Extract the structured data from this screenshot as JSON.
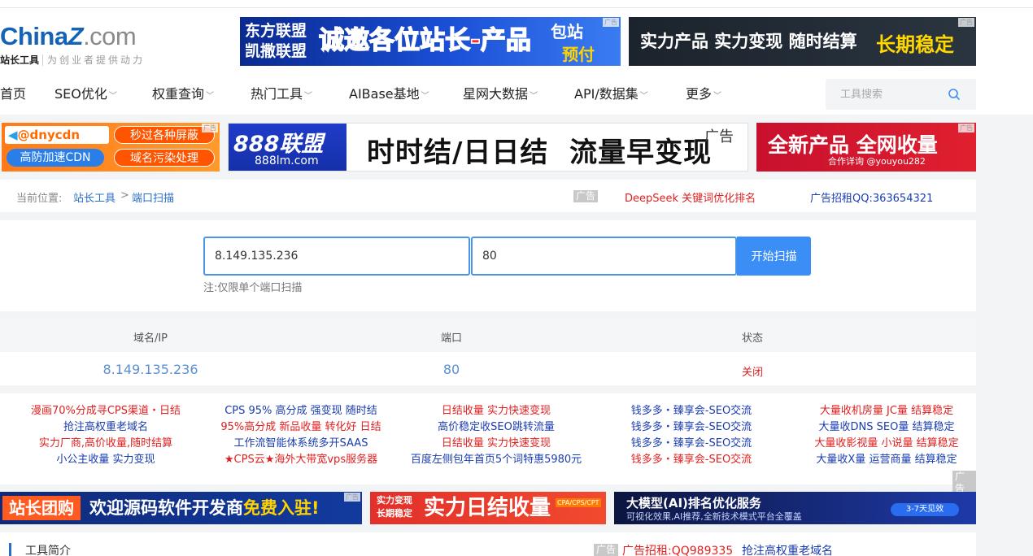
{
  "logo": {
    "part1": "China",
    "part2": "Z",
    "part3": ".com",
    "sub1": "站长工具",
    "sub2": "为创业者提供动力"
  },
  "ad_tag": "广告",
  "ads_top": {
    "ad1": {
      "left": "东方联盟\n凯撒联盟",
      "main": "诚邀各位站长-产品",
      "right1": "包站",
      "right2": "预付"
    },
    "ad2": {
      "left": "实力产品 实力变现 随时结算",
      "right": "长期稳定"
    }
  },
  "nav": {
    "items": [
      {
        "label": "首页",
        "chevron": false
      },
      {
        "label": "SEO优化",
        "chevron": true
      },
      {
        "label": "权重查询",
        "chevron": true
      },
      {
        "label": "热门工具",
        "chevron": true
      },
      {
        "label": "AIBase基地",
        "chevron": true
      },
      {
        "label": "星网大数据",
        "chevron": true
      },
      {
        "label": "API/数据集",
        "chevron": true
      },
      {
        "label": "更多",
        "chevron": true
      }
    ],
    "search_placeholder": "工具搜索"
  },
  "ads_row2": {
    "ad3": {
      "a": "@dnycdn",
      "b": "秒过各种屏蔽",
      "c": "高防加速CDN",
      "d": "域名污染处理"
    },
    "ad4": {
      "logo": "888联盟",
      "url": "888lm.com",
      "slogan": "时时结/日日结  流量早变现",
      "tag": "广告"
    },
    "ad5": {
      "title": "全新产品 全网收量",
      "sub": "合作详询 @youyou282"
    }
  },
  "breadcrumb": {
    "label": "当前位置:",
    "link1": "站长工具",
    "sep": ">",
    "link2": "端口扫描",
    "ad_link1": "DeepSeek 关键词优化排名",
    "ad_link2": "广告招租QQ:363654321"
  },
  "scan": {
    "ip_value": "8.149.135.236",
    "port_value": "80",
    "button": "开始扫描",
    "note": "注:仅限单个端口扫描"
  },
  "result": {
    "headers": [
      "域名/IP",
      "端口",
      "状态"
    ],
    "rows": [
      {
        "ip": "8.149.135.236",
        "port": "80",
        "status": "关闭"
      }
    ]
  },
  "link_columns": [
    [
      {
        "text": "漫画70%分成寻CPS渠道・日结",
        "color": "red"
      },
      {
        "text": "抢注高权重老域名",
        "color": "blue"
      },
      {
        "text": "实力厂商,高价收量,随时结算",
        "color": "red"
      },
      {
        "text": "小公主收量 实力变现",
        "color": "blue"
      }
    ],
    [
      {
        "text": "CPS 95% 高分成 强变现 随时结",
        "color": "blue"
      },
      {
        "text": "95%高分成 新品收量 转化好 日结",
        "color": "red"
      },
      {
        "text": "工作流智能体系统多开SAAS",
        "color": "blue"
      },
      {
        "text": "★CPS云★海外大带宽vps服务器",
        "color": "red"
      }
    ],
    [
      {
        "text": "日结收量 实力快速变现",
        "color": "red"
      },
      {
        "text": "高价稳定收SEO跳转流量",
        "color": "blue"
      },
      {
        "text": "日结收量 实力快速变现",
        "color": "red"
      },
      {
        "text": "百度左侧包年首页5个词特惠5980元",
        "color": "blue"
      }
    ],
    [
      {
        "text": "钱多多・臻享会-SEO交流",
        "color": "blue"
      },
      {
        "text": "钱多多・臻享会-SEO交流",
        "color": "blue"
      },
      {
        "text": "钱多多・臻享会-SEO交流",
        "color": "blue"
      },
      {
        "text": "钱多多・臻享会-SEO交流",
        "color": "red"
      }
    ],
    [
      {
        "text": "大量收机房量 JC量 结算稳定",
        "color": "red"
      },
      {
        "text": "大量收DNS SEO量 结算稳定",
        "color": "blue"
      },
      {
        "text": "大量收影视量 小说量 结算稳定",
        "color": "red"
      },
      {
        "text": "大量收X量 运营商量 结算稳定",
        "color": "blue"
      }
    ]
  ],
  "ads_bottom": {
    "ad6": {
      "a": "站长团购",
      "b1": "欢迎源码软件开发商",
      "b2": "免费入驻!"
    },
    "ad7": {
      "a1": "实力变现",
      "a2": "长期稳定",
      "b": "实力日结收量",
      "c": "CPA/CPS/CPT"
    },
    "ad8": {
      "a": "大模型(AI)排名优化服务",
      "b": "可视化效果,AI推荐,全新技术模式平台全覆盖",
      "c": "3-7天见效"
    }
  },
  "intro": {
    "title": "工具简介",
    "ad_link1": "广告招租:QQ989335",
    "ad_link2": "抢注高权重老域名"
  }
}
